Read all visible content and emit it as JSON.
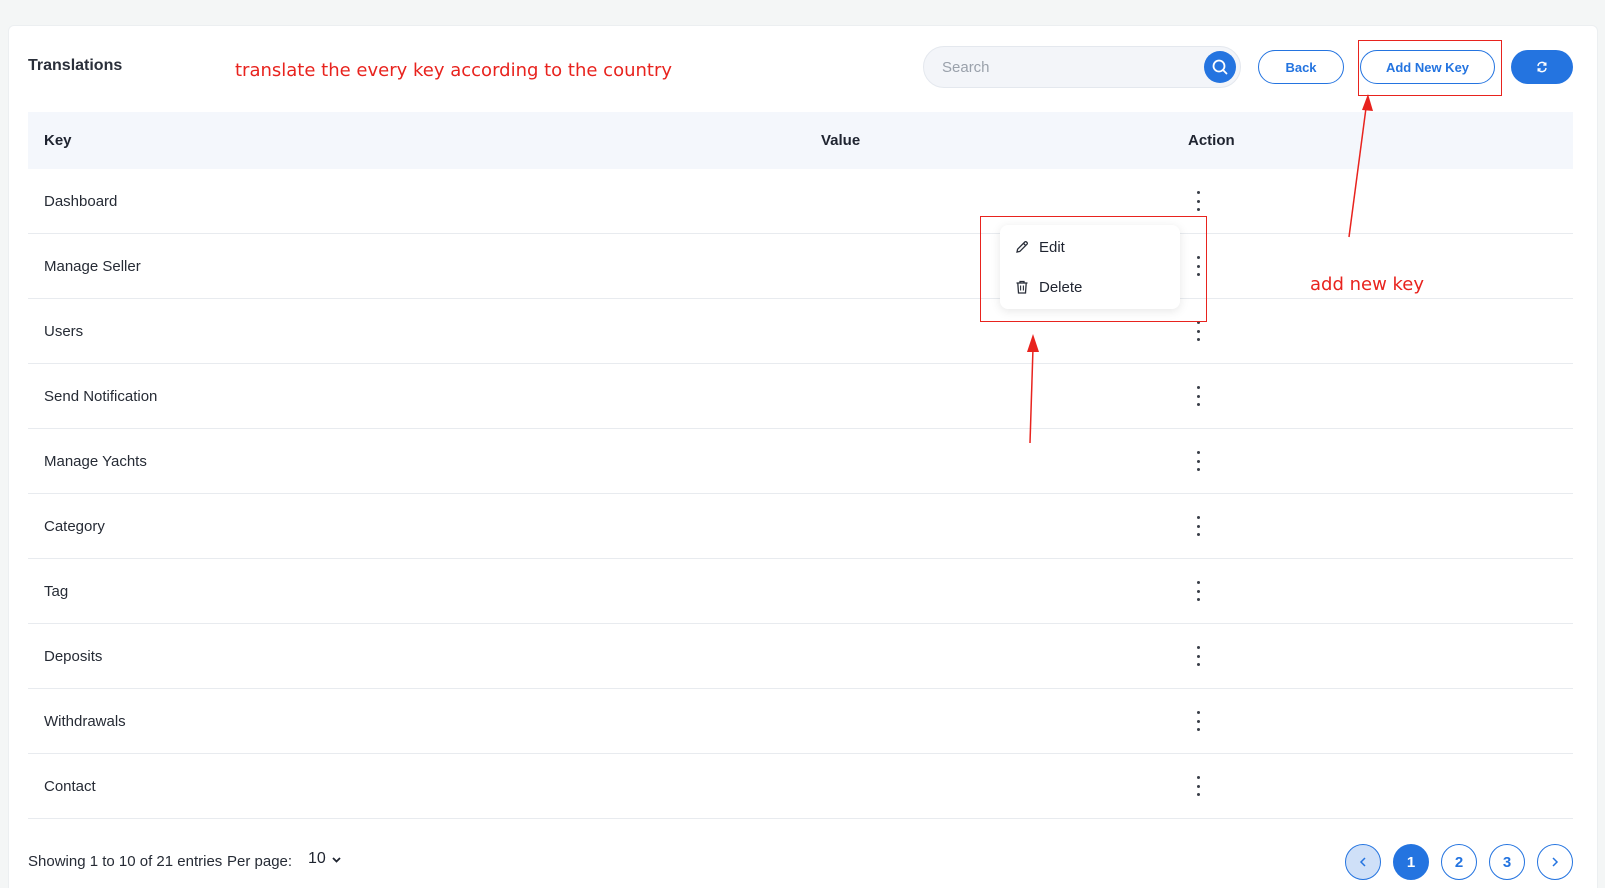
{
  "header": {
    "title": "Translations",
    "search_placeholder": "Search",
    "back_label": "Back",
    "add_key_label": "Add New Key"
  },
  "annotations": {
    "top_note": "translate the every key according to the country",
    "add_key_note": "add new key"
  },
  "table": {
    "columns": [
      "Key",
      "Value",
      "Action"
    ],
    "rows": [
      "Dashboard",
      "Manage Seller",
      "Users",
      "Send Notification",
      "Manage Yachts",
      "Category",
      "Tag",
      "Deposits",
      "Withdrawals",
      "Contact"
    ]
  },
  "action_menu": {
    "edit_label": "Edit",
    "delete_label": "Delete"
  },
  "footer": {
    "showing": "Showing 1 to 10 of 21 entries",
    "per_page_label": "Per page:",
    "per_page_value": "10",
    "pages": [
      "1",
      "2",
      "3"
    ]
  },
  "colors": {
    "accent": "#2474e0",
    "annotation": "#e8231e"
  }
}
